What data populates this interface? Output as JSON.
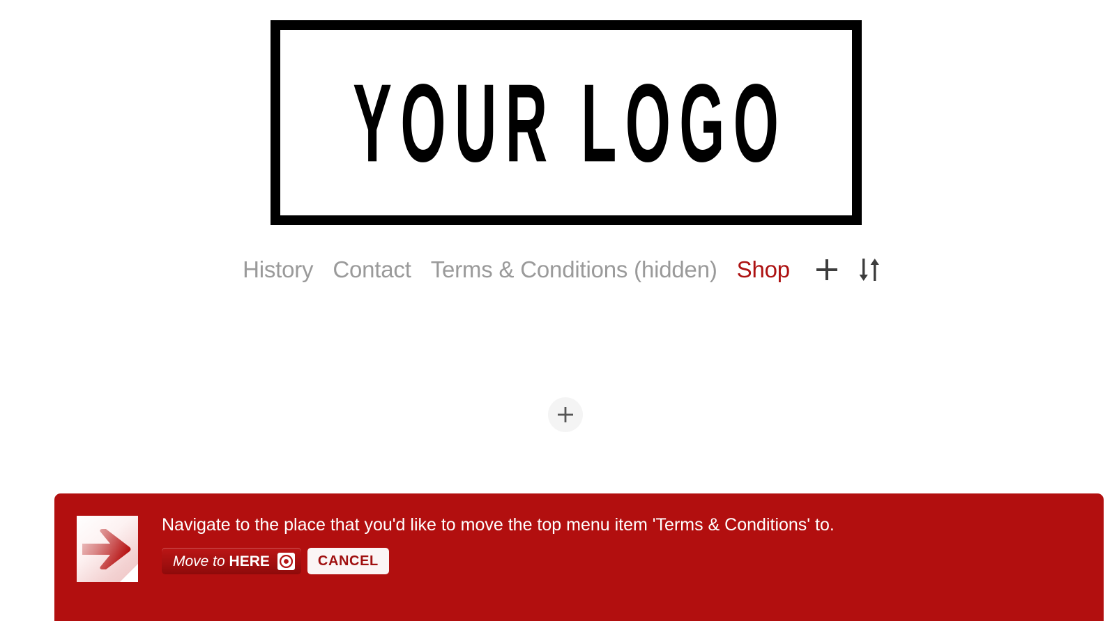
{
  "logo": {
    "text": "YOUR LOGO",
    "border_color": "#000000"
  },
  "topnav": {
    "items": [
      {
        "label": "History",
        "state": "normal"
      },
      {
        "label": "Contact",
        "state": "normal"
      },
      {
        "label": "Terms & Conditions (hidden)",
        "state": "normal"
      },
      {
        "label": "Shop",
        "state": "active"
      }
    ],
    "add_page_icon": "plus-icon",
    "reorder_icon": "sort-up-down-icon",
    "active_color": "#ad1111",
    "link_color": "#8e8e8e"
  },
  "content": {
    "add_block_icon": "plus-icon",
    "add_block_label": "+"
  },
  "banner": {
    "message": "Navigate to the place that you'd like to move the top menu item 'Terms & Conditions' to.",
    "icon": "move-document-arrow-icon",
    "background_color": "#b20f0f",
    "move_button": {
      "prefix": "Move to",
      "emphasis": "HERE",
      "icon": "target-icon"
    },
    "cancel_button": {
      "label": "CANCEL"
    }
  }
}
